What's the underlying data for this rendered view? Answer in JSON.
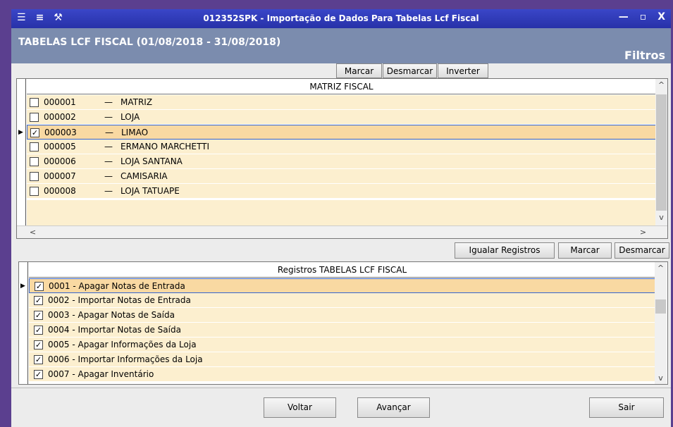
{
  "titlebar": {
    "title": "012352SPK - Importação de Dados Para Tabelas Lcf Fiscal",
    "menu_icon": "menu-icon",
    "app_icon": "app-icon",
    "tool_icon": "wrench-icon",
    "minimize": "—",
    "maximize": "▫",
    "close": "X"
  },
  "header": {
    "title": "TABELAS LCF FISCAL (01/08/2018 - 31/08/2018)",
    "filtros": "Filtros"
  },
  "top_buttons": {
    "marcar": "Marcar",
    "desmarcar": "Desmarcar",
    "inverter": "Inverter"
  },
  "matriz": {
    "header": "MATRIZ FISCAL",
    "rows": [
      {
        "code": "000001",
        "name": "MATRIZ",
        "checked": false
      },
      {
        "code": "000002",
        "name": "LOJA",
        "checked": false
      },
      {
        "code": "000003",
        "name": "LIMAO",
        "checked": true
      },
      {
        "code": "000005",
        "name": "ERMANO MARCHETTI",
        "checked": false
      },
      {
        "code": "000006",
        "name": "LOJA SANTANA",
        "checked": false
      },
      {
        "code": "000007",
        "name": "CAMISARIA",
        "checked": false
      },
      {
        "code": "000008",
        "name": "LOJA TATUAPE",
        "checked": false
      }
    ],
    "dash": "—"
  },
  "mid_buttons": {
    "igualar": "Igualar Registros",
    "marcar": "Marcar",
    "desmarcar": "Desmarcar"
  },
  "registros": {
    "header": "Registros TABELAS LCF FISCAL",
    "rows": [
      {
        "label": "0001 - Apagar Notas de Entrada",
        "checked": true
      },
      {
        "label": "0002 - Importar Notas de Entrada",
        "checked": true
      },
      {
        "label": "0003 - Apagar Notas de Saída",
        "checked": true
      },
      {
        "label": "0004 - Importar Notas de Saída",
        "checked": true
      },
      {
        "label": "0005 - Apagar Informações da Loja",
        "checked": true
      },
      {
        "label": "0006 - Importar Informações da Loja",
        "checked": true
      },
      {
        "label": "0007 - Apagar Inventário",
        "checked": true
      }
    ]
  },
  "footer": {
    "voltar": "Voltar",
    "avancar": "Avançar",
    "sair": "Sair"
  },
  "scroll": {
    "up": "^",
    "down": "v",
    "left": "<",
    "right": ">"
  }
}
